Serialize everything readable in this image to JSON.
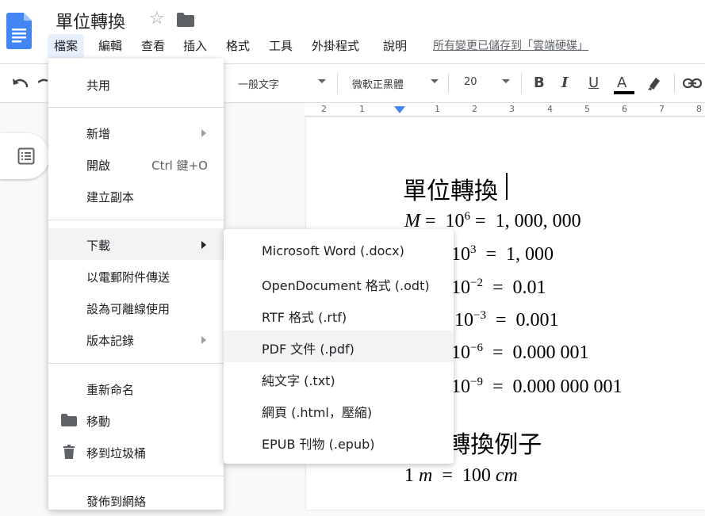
{
  "doc": {
    "title": "單位轉換",
    "save_status": "所有變更已儲存到「雲端硬碟」"
  },
  "menubar": [
    "檔案",
    "編輯",
    "查看",
    "插入",
    "格式",
    "工具",
    "外掛程式",
    "說明"
  ],
  "toolbar": {
    "style": "一般文字",
    "font": "微軟正黑體",
    "size": "20",
    "bold": "B",
    "italic": "I",
    "underline": "U",
    "text_color": "A",
    "text_color_value": "#000000"
  },
  "ruler": [
    "2",
    "1",
    "1",
    "2",
    "3",
    "4",
    "5",
    "6",
    "7",
    "8"
  ],
  "document": {
    "heading": "單位轉換",
    "equations": [
      {
        "lhs": "M",
        "base": "10",
        "exp": "6",
        "rhs": "1, 000, 000"
      },
      {
        "lhs": "",
        "base": "10",
        "exp": "3",
        "rhs": "1, 000"
      },
      {
        "lhs": "",
        "base": "10",
        "exp": "−2",
        "rhs": "0.01"
      },
      {
        "lhs": "",
        "base": "10",
        "exp": "−3",
        "rhs": "0.001"
      },
      {
        "lhs": "",
        "base": "10",
        "exp": "−6",
        "rhs": "0.000 001"
      },
      {
        "lhs": "",
        "base": "10",
        "exp": "−9",
        "rhs": "0.000 000 001"
      }
    ],
    "heading2": "轉換例子",
    "example": {
      "a": "1",
      "u1": "m",
      "b": "100",
      "u2": "cm"
    }
  },
  "file_menu": {
    "share": "共用",
    "new": "新增",
    "open": "開啟",
    "open_shortcut": "Ctrl 鍵+O",
    "copy": "建立副本",
    "download": "下載",
    "email": "以電郵附件傳送",
    "offline": "設為可離線使用",
    "version": "版本記錄",
    "rename": "重新命名",
    "move": "移動",
    "trash": "移到垃圾桶",
    "publish": "發佈到網絡"
  },
  "download_menu": [
    "Microsoft Word (.docx)",
    "OpenDocument 格式 (.odt)",
    "RTF 格式 (.rtf)",
    "PDF 文件 (.pdf)",
    "純文字 (.txt)",
    "網頁 (.html，壓縮)",
    "EPUB 刊物 (.epub)"
  ],
  "colors": {
    "docs_blue": "#4285f4",
    "highlight": "#f1f3f4",
    "menu_active": "#e8f0fe"
  }
}
